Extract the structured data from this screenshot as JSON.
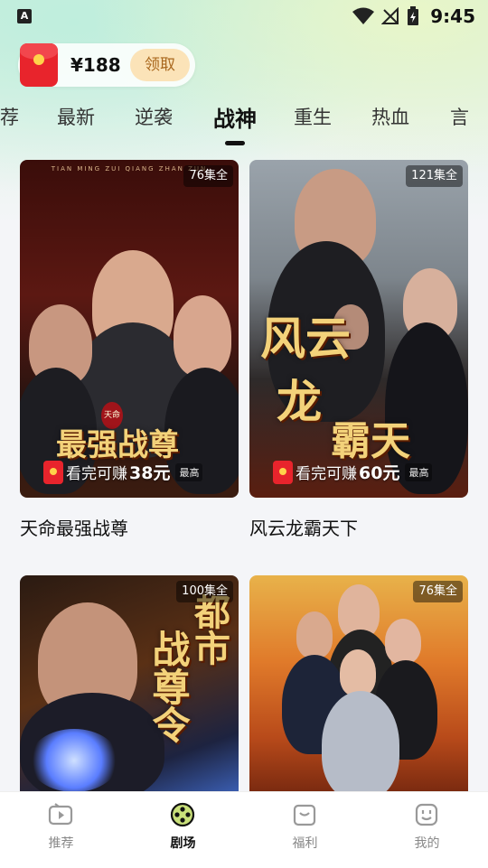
{
  "status_bar": {
    "app_badge": "A",
    "time": "9:45",
    "icons": [
      "wifi-icon",
      "no-signal-icon",
      "battery-charging-icon"
    ]
  },
  "reward": {
    "amount": "¥188",
    "claim_label": "领取",
    "icon": "red-envelope-icon"
  },
  "tabs": [
    {
      "label": "荐",
      "active": false
    },
    {
      "label": "最新",
      "active": false
    },
    {
      "label": "逆袭",
      "active": false
    },
    {
      "label": "战神",
      "active": true
    },
    {
      "label": "重生",
      "active": false
    },
    {
      "label": "热血",
      "active": false
    },
    {
      "label": "言",
      "active": false
    }
  ],
  "cards": [
    {
      "title": "天命最强战尊",
      "episodes": "76集全",
      "earn_text": "看完可赚",
      "earn_amount": "38元",
      "earn_note": "最高",
      "poster_text": "最强战尊",
      "poster_top_text": "TIAN MING ZUI QIANG ZHAN ZUN",
      "poster_seal": "天命"
    },
    {
      "title": "风云龙霸天下",
      "episodes": "121集全",
      "earn_text": "看完可赚",
      "earn_amount": "60元",
      "earn_note": "最高",
      "poster_text_a": "风云",
      "poster_text_b": "龙",
      "poster_text_c": "霸天"
    },
    {
      "title": "",
      "episodes": "100集全",
      "poster_text_a": "都市",
      "poster_text_b": "战尊令"
    },
    {
      "title": "",
      "episodes": "76集全"
    }
  ],
  "bottom_nav": [
    {
      "label": "推荐",
      "icon": "play-screen-icon",
      "active": false
    },
    {
      "label": "剧场",
      "icon": "film-reel-icon",
      "active": true
    },
    {
      "label": "福利",
      "icon": "gift-box-icon",
      "active": false
    },
    {
      "label": "我的",
      "icon": "smile-face-icon",
      "active": false
    }
  ],
  "colors": {
    "accent_red": "#e8242c",
    "claim_bg": "#fbe3b8",
    "claim_text": "#a9671d",
    "active_nav_icon": "#c9e07a"
  }
}
